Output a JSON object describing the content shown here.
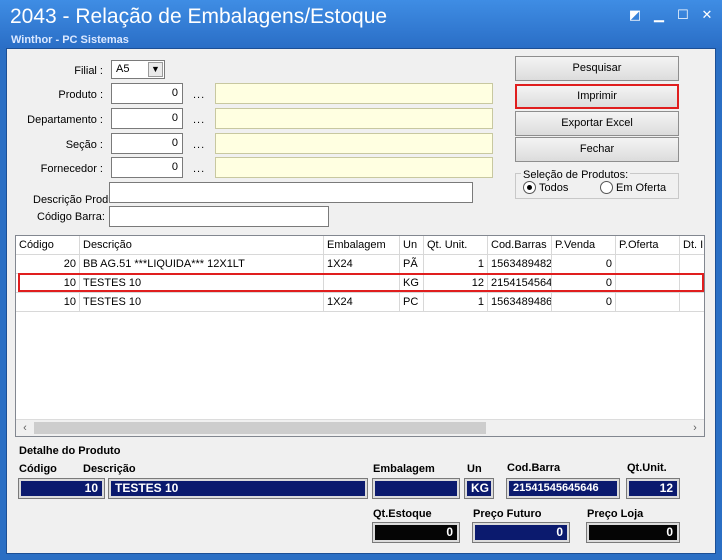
{
  "window": {
    "title": "2043 - Relação de Embalagens/Estoque",
    "subtitle": "Winthor - PC Sistemas"
  },
  "filters": {
    "filial_label": "Filial :",
    "filial_value": "A5",
    "produto_label": "Produto :",
    "produto_value": "0",
    "departamento_label": "Departamento :",
    "departamento_value": "0",
    "secao_label": "Seção :",
    "secao_value": "0",
    "fornecedor_label": "Fornecedor :",
    "fornecedor_value": "0",
    "lookup_dots": "...",
    "descricao_label": "Descrição Produto",
    "descricao_value": "",
    "codigo_barra_label": "Código Barra:",
    "codigo_barra_value": ""
  },
  "buttons": {
    "pesquisar": "Pesquisar",
    "imprimir": "Imprimir",
    "exportar": "Exportar Excel",
    "fechar": "Fechar"
  },
  "selection": {
    "title": "Seleção de Produtos:",
    "todos": "Todos",
    "em_oferta": "Em Oferta",
    "selected": "Todos"
  },
  "grid": {
    "columns": [
      "Código",
      "Descrição",
      "Embalagem",
      "Un",
      "Qt. Unit.",
      "Cod.Barras",
      "P.Venda",
      "P.Oferta",
      "Dt. I"
    ],
    "rows": [
      [
        "20",
        "BB AG.51 ***LIQUIDA*** 12X1LT",
        "1X24",
        "PÃ",
        "1",
        "1563489482",
        "0",
        "",
        ""
      ],
      [
        "10",
        "TESTES 10",
        "",
        "KG",
        "12",
        "2154154564",
        "0",
        "",
        ""
      ],
      [
        "10",
        "TESTES 10",
        "1X24",
        "PC",
        "1",
        "1563489486",
        "0",
        "",
        ""
      ]
    ]
  },
  "detail": {
    "section_title": "Detalhe do Produto",
    "codigo_label": "Código",
    "codigo": "10",
    "descricao_label": "Descrição",
    "descricao": "TESTES 10",
    "embalagem_label": "Embalagem",
    "embalagem": "",
    "un_label": "Un",
    "un": "KG",
    "cod_barra_label": "Cod.Barra",
    "cod_barra": "21541545645646",
    "qt_unit_label": "Qt.Unit.",
    "qt_unit": "12",
    "qt_estoque_label": "Qt.Estoque",
    "qt_estoque": "0",
    "preco_futuro_label": "Preço Futuro",
    "preco_futuro": "0",
    "preco_loja_label": "Preço Loja",
    "preco_loja": "0"
  },
  "colors": {
    "title_bar": "#2a6ec6",
    "highlight": "#e01e1e",
    "detail_blue": "#0b1a6e",
    "lookup_yellow": "#ffffe1"
  }
}
